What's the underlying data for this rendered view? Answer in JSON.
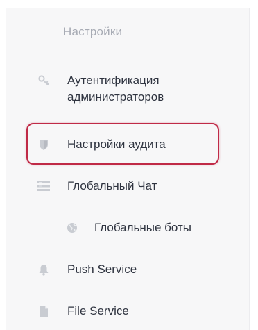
{
  "sidebar": {
    "section_title": "Настройки",
    "items": [
      {
        "label": "Аутентификация\nадминистраторов",
        "icon": "key-icon"
      },
      {
        "label": "Настройки аудита",
        "icon": "shield-icon",
        "highlighted": true
      },
      {
        "label": "Глобальный Чат",
        "icon": "list-icon"
      },
      {
        "label": "Глобальные боты",
        "icon": "globe-icon",
        "indented": true
      },
      {
        "label": "Push Service",
        "icon": "bell-icon"
      },
      {
        "label": "File Service",
        "icon": "file-icon"
      }
    ]
  },
  "colors": {
    "highlight": "#c02a47",
    "icon": "#c9ccd2",
    "text": "#2f3440",
    "section_title": "#a7abb4",
    "panel_background": "#f7f7f8"
  }
}
